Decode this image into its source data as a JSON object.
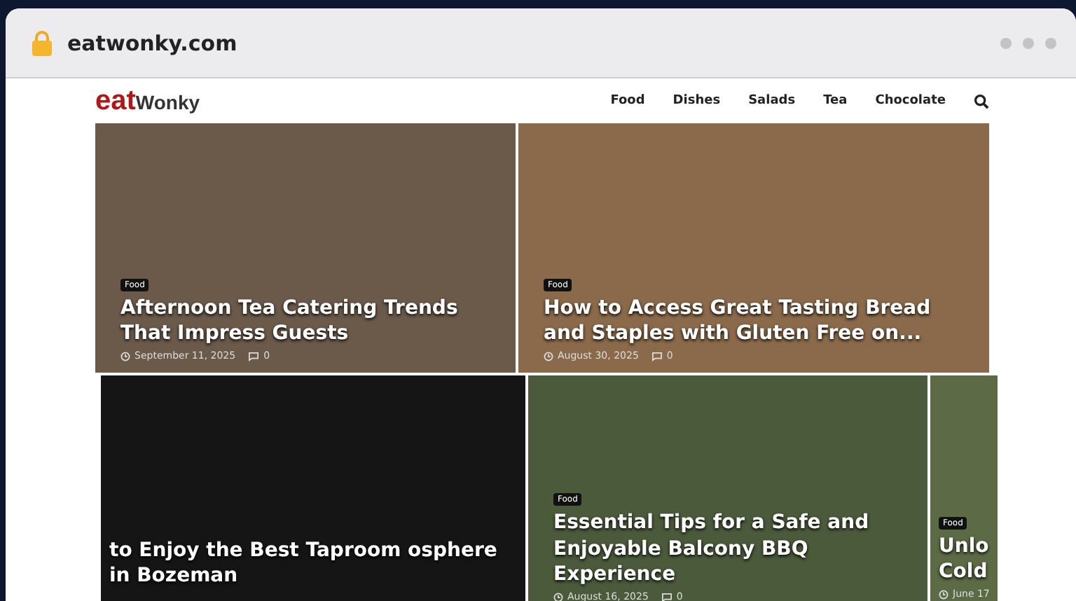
{
  "browser": {
    "url": "eatwonky.com"
  },
  "site": {
    "logo_prefix": "eat",
    "logo_name": "Wonky",
    "nav": [
      "Food",
      "Dishes",
      "Salads",
      "Tea",
      "Chocolate"
    ]
  },
  "top_cards": [
    {
      "tag": "Food",
      "title": "Afternoon Tea Catering Trends That Impress Guests",
      "date": "September 11, 2025",
      "comments": "0"
    },
    {
      "tag": "Food",
      "title": "How to Access Great Tasting Bread and Staples with Gluten Free on...",
      "date": "August 30, 2025",
      "comments": "0"
    }
  ],
  "bottom_cards": [
    {
      "title": "to Enjoy the Best Taproom osphere in Bozeman"
    },
    {
      "tag": "Food",
      "title": "Essential Tips for a Safe and Enjoyable Balcony BBQ Experience",
      "date": "August 16, 2025",
      "comments": "0"
    },
    {
      "tag": "Food",
      "title": "Unlo Cold",
      "date": "June 17"
    }
  ]
}
